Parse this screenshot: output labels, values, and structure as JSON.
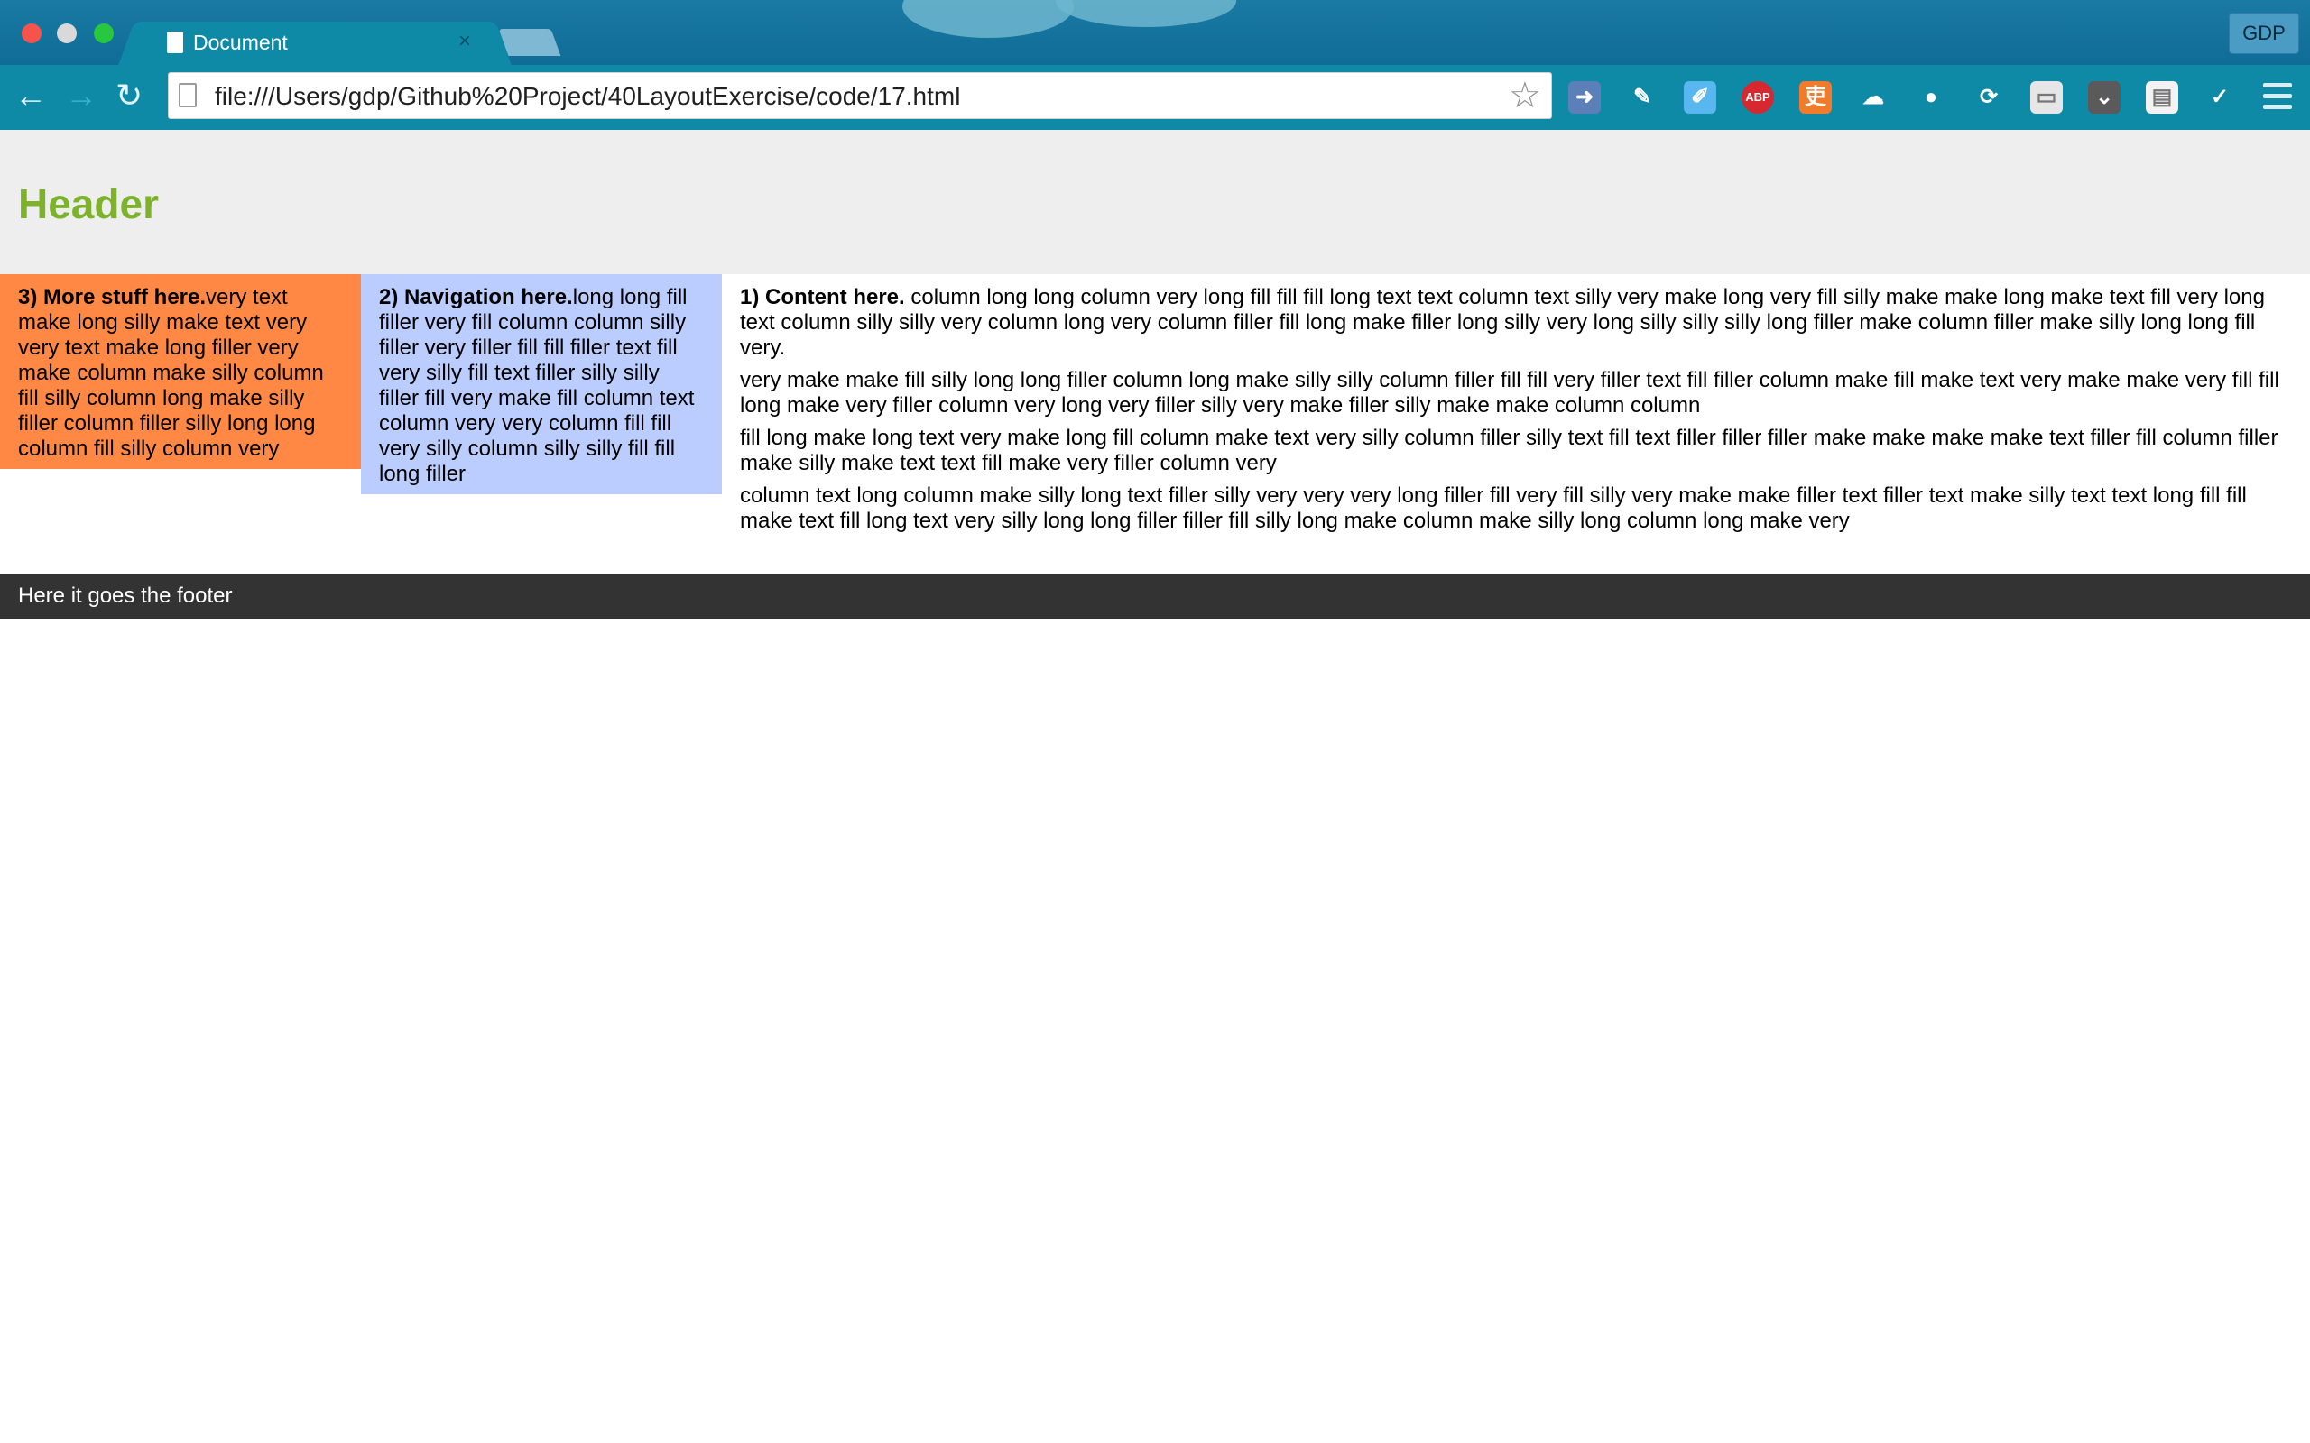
{
  "browser": {
    "tab_title": "Document",
    "tab_close": "×",
    "profile_label": "GDP",
    "url": "file:///Users/gdp/Github%20Project/40LayoutExercise/code/17.html",
    "icons": {
      "back": "back-arrow-icon",
      "forward": "forward-arrow-icon",
      "reload": "reload-icon",
      "star": "bookmark-star-icon",
      "menu": "hamburger-menu-icon"
    },
    "extensions": [
      {
        "name": "share-extension-icon",
        "color": "#5b7fb8",
        "glyph": "➜"
      },
      {
        "name": "evernote-extension-icon",
        "color": "#0f8aa6",
        "glyph": "✎"
      },
      {
        "name": "note-extension-icon",
        "color": "#59b7f0",
        "glyph": "✐"
      },
      {
        "name": "adblock-extension-icon",
        "color": "#d7282f",
        "glyph": "ABP"
      },
      {
        "name": "translate-extension-icon",
        "color": "#f07c2b",
        "glyph": "吏"
      },
      {
        "name": "cloud-extension-icon",
        "color": "#0f8aa6",
        "glyph": "☁"
      },
      {
        "name": "drop-extension-icon",
        "color": "#0f8aa6",
        "glyph": "●"
      },
      {
        "name": "sync-extension-icon",
        "color": "#0f8aa6",
        "glyph": "⟳"
      },
      {
        "name": "lock-extension-icon",
        "color": "#e6e6e6",
        "glyph": "▭"
      },
      {
        "name": "pocket-extension-icon",
        "color": "#5a5a5a",
        "glyph": "⌄"
      },
      {
        "name": "calendar-extension-icon",
        "color": "#f3f3f3",
        "glyph": "▤"
      },
      {
        "name": "check-extension-icon",
        "color": "#0f8aa6",
        "glyph": "✓"
      }
    ]
  },
  "page": {
    "header_title": "Header",
    "more": {
      "heading": "3) More stuff here.",
      "text": "very text make long silly make text very very text make long filler very make column make silly column fill silly column long make silly filler column filler silly long long column fill silly column very"
    },
    "nav": {
      "heading": "2) Navigation here.",
      "text": "long long fill filler very fill column column silly filler very filler fill fill filler text fill very silly fill text filler silly silly filler fill very make fill column text column very very column fill fill very silly column silly silly fill fill long filler"
    },
    "content": {
      "heading": "1) Content here.",
      "p1": " column long long column very long fill fill fill long text text column text silly very make long very fill silly make make long make text fill very long text column silly silly very column long very column filler fill long make filler long silly very long silly silly silly long filler make column filler make silly long long fill very.",
      "p2": "very make make fill silly long long filler column long make silly silly column filler fill fill very filler text fill filler column make fill make text very make make very fill fill long make very filler column very long very filler silly very make filler silly make make column column",
      "p3": "fill long make long text very make long fill column make text very silly column filler silly text fill text filler filler filler make make make make text filler fill column filler make silly make text text fill make very filler column very",
      "p4": "column text long column make silly long text filler silly very very very long filler fill very fill silly very make make filler text filler text make silly text text long fill fill make text fill long text very silly long long filler filler fill silly long make column make silly long column long make very"
    },
    "footer_text": "Here it goes the footer",
    "colors": {
      "header_bg": "#eeeeee",
      "header_text": "#7db32a",
      "more_bg": "#ff8844",
      "nav_bg": "#bbccff",
      "footer_bg": "#333333"
    }
  }
}
